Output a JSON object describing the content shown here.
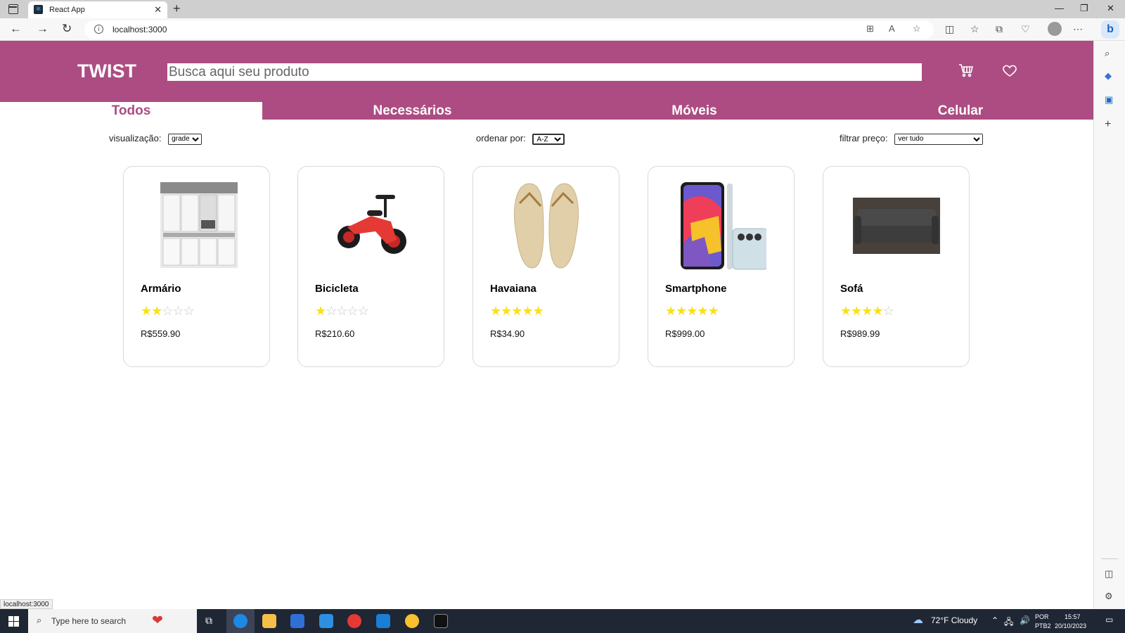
{
  "browser": {
    "tab_title": "React App",
    "tab_close": "✕",
    "new_tab": "+",
    "url": "localhost:3000",
    "status_url": "localhost:3000"
  },
  "header": {
    "logo": "TWIST",
    "search_placeholder": "Busca aqui seu produto"
  },
  "categories": [
    {
      "label": "Todos",
      "active": true
    },
    {
      "label": "Necessários",
      "active": false
    },
    {
      "label": "Móveis",
      "active": false
    },
    {
      "label": "Celular",
      "active": false
    }
  ],
  "controls": {
    "view_label": "visualização:",
    "view_value": "grade",
    "sort_label": "ordenar por:",
    "sort_value": "A-Z",
    "price_label": "filtrar preço:",
    "price_value": "ver tudo"
  },
  "products": [
    {
      "name": "Armário",
      "rating": 2,
      "max_rating": 5,
      "price": "R$559.90",
      "image": "kitchen-cabinet"
    },
    {
      "name": "Bicicleta",
      "rating": 1,
      "max_rating": 5,
      "price": "R$210.60",
      "image": "balance-bike"
    },
    {
      "name": "Havaiana",
      "rating": 5,
      "max_rating": 5,
      "price": "R$34.90",
      "image": "flip-flops"
    },
    {
      "name": "Smartphone",
      "rating": 5,
      "max_rating": 5,
      "price": "R$999.00",
      "image": "smartphone"
    },
    {
      "name": "Sofá",
      "rating": 4,
      "max_rating": 5,
      "price": "R$989.99",
      "image": "sofa"
    }
  ],
  "taskbar": {
    "search_placeholder": "Type here to search",
    "weather": "72°F  Cloudy",
    "lang_1": "POR",
    "lang_2": "PTB2",
    "time": "15:57",
    "date": "20/10/2023"
  },
  "colors": {
    "brand": "#ac4c82",
    "star": "#f7e11a"
  }
}
